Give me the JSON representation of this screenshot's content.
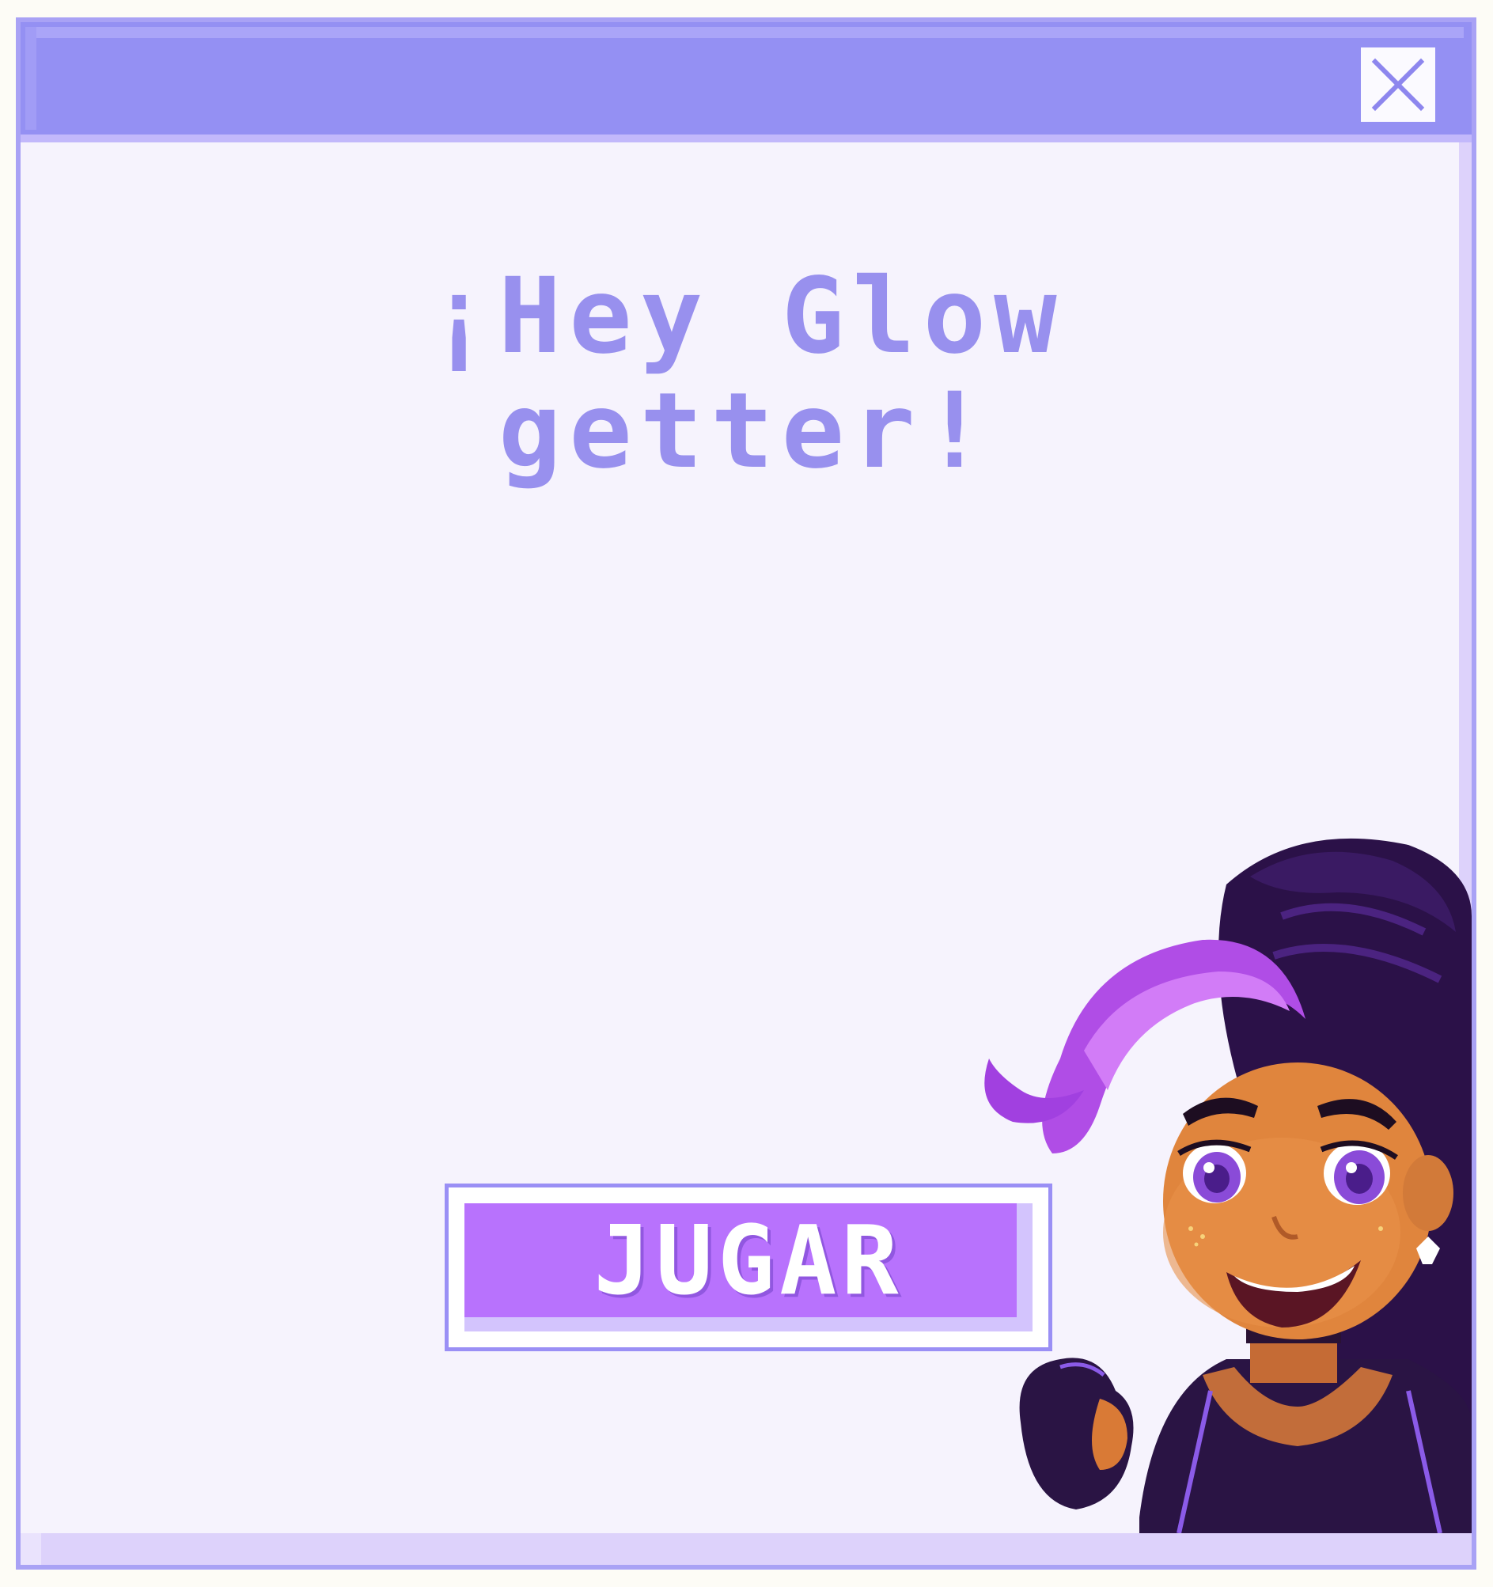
{
  "dialog": {
    "heading_line1": "¡Hey Glow",
    "heading_line2": "getter!",
    "play_button": "JUGAR",
    "close_icon": "close-icon",
    "character": "character-illustration"
  },
  "colors": {
    "titlebar": "#9490f3",
    "window_border": "#a9a2f5",
    "content_bg": "#f6f3fd",
    "heading": "#9890ee",
    "button_face": "#b872fd",
    "button_border": "#9a8ff5"
  }
}
